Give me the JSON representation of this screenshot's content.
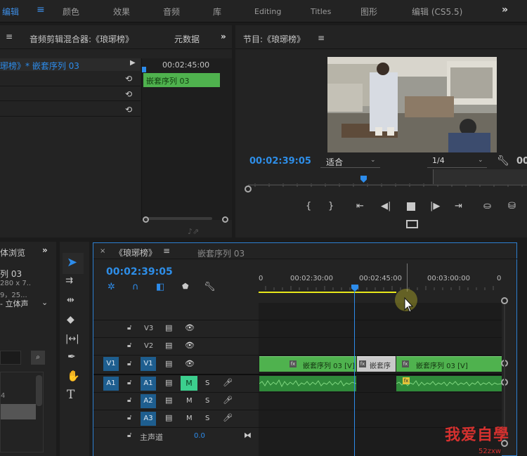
{
  "workspace": {
    "tabs": [
      "编辑",
      "颜色",
      "效果",
      "音频",
      "库",
      "Editing",
      "Titles",
      "图形",
      "编辑 (CS5.5)"
    ],
    "active": "编辑",
    "menu_icon": "hamburger-icon",
    "overflow": "»"
  },
  "mixer_panel": {
    "tab_mixer": "音频剪辑混合器:《琅琊榜》",
    "tab_metadata": "元数据",
    "overflow": "»",
    "clip_path": "琊榜》* 嵌套序列 03",
    "timecode": "00:02:45:00",
    "clip_name": "嵌套序列 03"
  },
  "program_monitor": {
    "title": "节目:《琅琊榜》",
    "timecode": "00:02:39:05",
    "fit": "适合",
    "resolution": "1/4",
    "right_time": "00"
  },
  "project_panel": {
    "title": "体浏览",
    "overflow": "»",
    "item_name": "列 03",
    "item_info1": "280 x 7..",
    "item_info2": "9，25...",
    "item_audio": "- 立体声",
    "small_num": "4"
  },
  "timeline": {
    "tab_active": "《琅琊榜》",
    "tab_other": "嵌套序列 03",
    "timecode": "00:02:39:05",
    "ruler": [
      "0",
      "00:02:30:00",
      "00:02:45:00",
      "00:03:00:00",
      "0"
    ],
    "tracks": [
      {
        "id": "V3",
        "src": ""
      },
      {
        "id": "V2",
        "src": ""
      },
      {
        "id": "V1",
        "src": "V1"
      },
      {
        "id": "A1",
        "src": "A1"
      },
      {
        "id": "A2",
        "src": ""
      },
      {
        "id": "A3",
        "src": ""
      }
    ],
    "master_label": "主声道",
    "master_value": "0.0",
    "mute": "M",
    "solo": "S",
    "clips": [
      "嵌套序列 03 [V]",
      "嵌套序",
      "嵌套序列 03 [V]"
    ],
    "fx_label": "fx"
  },
  "watermark": {
    "text": "我爱自學",
    "url": "52zxw"
  },
  "colors": {
    "accent": "#2d8ceb",
    "clip_green": "#4fb24e",
    "track_blue": "#1e5e8f",
    "work_area_yellow": "#e8e81a"
  }
}
